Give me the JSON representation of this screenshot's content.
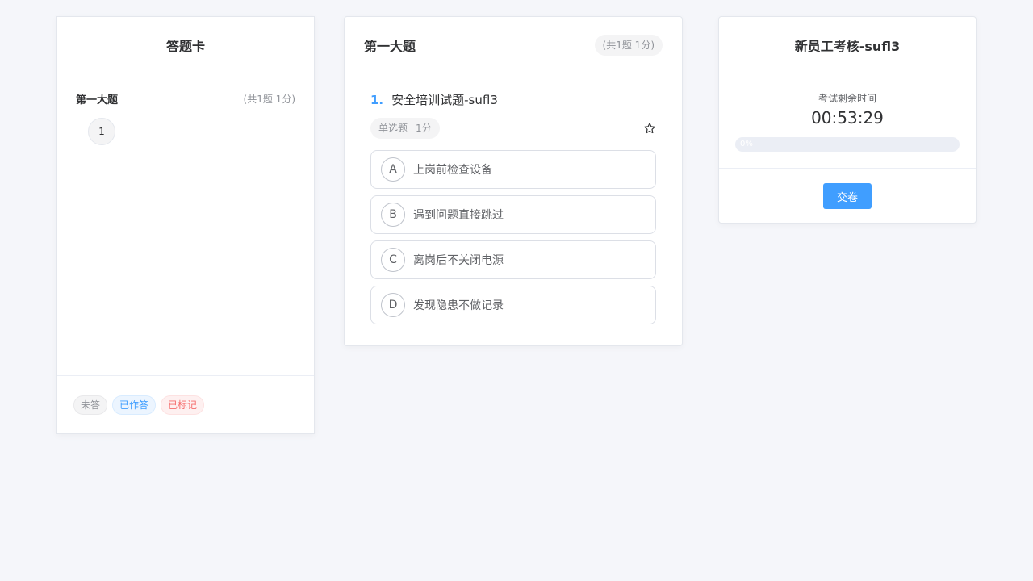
{
  "answer_card": {
    "title": "答题卡",
    "section_title": "第一大题",
    "section_count": "(共1题 1分)",
    "questions": [
      "1"
    ],
    "legend": {
      "unanswered": "未答",
      "answered": "已作答",
      "marked": "已标记"
    }
  },
  "question_card": {
    "section_title": "第一大题",
    "section_badge": "(共1题 1分)",
    "question": {
      "number": "1.",
      "text": "安全培训试题-sufl3",
      "type": "单选题",
      "score": "1分",
      "icon": "star-outline-icon",
      "options": [
        {
          "letter": "A",
          "text": "上岗前检查设备"
        },
        {
          "letter": "B",
          "text": "遇到问题直接跳过"
        },
        {
          "letter": "C",
          "text": "离岗后不关闭电源"
        },
        {
          "letter": "D",
          "text": "发现隐患不做记录"
        }
      ]
    }
  },
  "exam_card": {
    "title": "新员工考核-sufl3",
    "timer_label": "考试剩余时间",
    "timer_value": "00:53:29",
    "progress": 0,
    "progress_text": "0%",
    "submit_label": "交卷"
  },
  "colors": {
    "accent": "#409eff",
    "background": "#f5f6fa",
    "marked": "#f56c6c"
  }
}
